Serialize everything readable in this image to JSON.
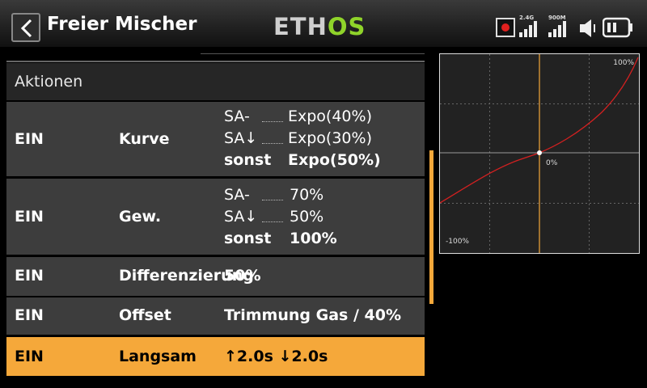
{
  "header": {
    "title": "Freier Mischer",
    "logo_part1": "ETH",
    "logo_part2": "OS",
    "signal_24g": "2.4G",
    "signal_900m": "900M"
  },
  "section_title": "Aktionen",
  "rows": [
    {
      "state": "EIN",
      "type": "Kurve",
      "conditions": [
        {
          "cond": "SA-",
          "value": "Expo(40%)"
        },
        {
          "cond": "SA↓",
          "value": "Expo(30%)"
        },
        {
          "cond": "sonst",
          "value": "Expo(50%)"
        }
      ]
    },
    {
      "state": "EIN",
      "type": "Gew.",
      "conditions": [
        {
          "cond": "SA-",
          "value": "70%"
        },
        {
          "cond": "SA↓",
          "value": "50%"
        },
        {
          "cond": "sonst",
          "value": "100%"
        }
      ]
    },
    {
      "state": "EIN",
      "type": "Differenzierung",
      "value": "50%"
    },
    {
      "state": "EIN",
      "type": "Offset",
      "value": "Trimmung Gas / 40%"
    },
    {
      "state": "EIN",
      "type": "Langsam",
      "value": "↑2.0s ↓2.0s",
      "selected": true
    }
  ],
  "graph": {
    "label_max": "100%",
    "label_center": "0%",
    "label_min": "-100%",
    "curve_color": "#d42020",
    "cursor_color": "#f5a83a"
  },
  "colors": {
    "accent": "#f5a83a",
    "logo_green": "#8fd32a",
    "record": "#e0201e"
  }
}
